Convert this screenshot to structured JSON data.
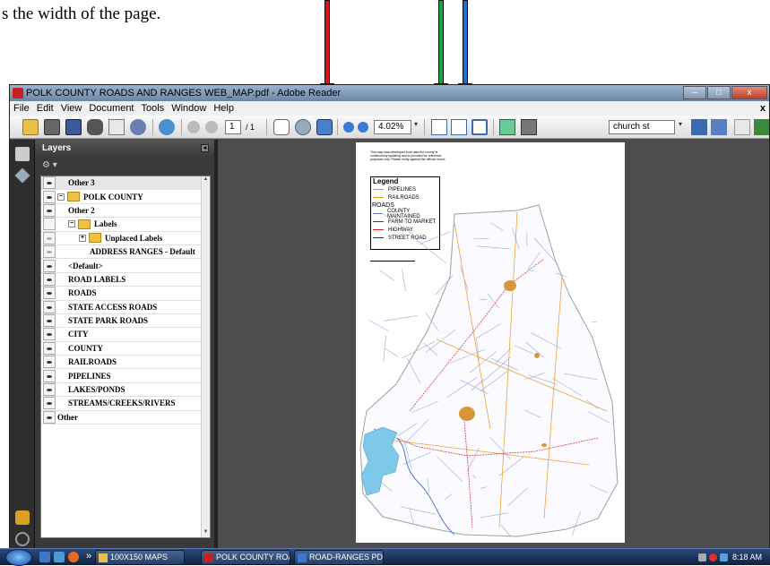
{
  "doc": {
    "caption": "s the width of the page."
  },
  "arrows": [
    {
      "name": "red",
      "color": "#e01414"
    },
    {
      "name": "green",
      "color": "#1aa83c"
    },
    {
      "name": "blue",
      "color": "#1f6fd6"
    }
  ],
  "window": {
    "title": "POLK COUNTY ROADS AND RANGES WEB_MAP.pdf - Adobe Reader",
    "controls": {
      "minimize": "–",
      "maximize": "□",
      "close": "x"
    }
  },
  "menu": {
    "items": [
      "File",
      "Edit",
      "View",
      "Document",
      "Tools",
      "Window",
      "Help"
    ],
    "close_doc": "x"
  },
  "toolbar": {
    "page_current": "1",
    "page_total": "/ 1",
    "zoom": "4.02%",
    "search_value": "church st"
  },
  "layers": {
    "title": "Layers",
    "options_label": "⚙ ▾",
    "collapse": "◂",
    "rows": [
      {
        "label": "Other 3",
        "indent": 1,
        "eye": "on",
        "folder": false,
        "plus": "",
        "selected": true
      },
      {
        "label": "POLK COUNTY",
        "indent": 0,
        "eye": "on",
        "folder": true,
        "plus": "−",
        "selected": false
      },
      {
        "label": "Other 2",
        "indent": 1,
        "eye": "on",
        "folder": false,
        "plus": "",
        "selected": false
      },
      {
        "label": "Labels",
        "indent": 1,
        "eye": "off",
        "folder": true,
        "plus": "−",
        "selected": false
      },
      {
        "label": "Unplaced Labels",
        "indent": 2,
        "eye": "dim",
        "folder": true,
        "plus": "+",
        "selected": false
      },
      {
        "label": "ADDRESS RANGES - Default",
        "indent": 3,
        "eye": "dim",
        "folder": false,
        "plus": "",
        "selected": false
      },
      {
        "label": "<Default>",
        "indent": 1,
        "eye": "on",
        "folder": false,
        "plus": "",
        "selected": false
      },
      {
        "label": "ROAD LABELS",
        "indent": 1,
        "eye": "on",
        "folder": false,
        "plus": "",
        "selected": false
      },
      {
        "label": "ROADS",
        "indent": 1,
        "eye": "on",
        "folder": false,
        "plus": "",
        "selected": false
      },
      {
        "label": "STATE ACCESS ROADS",
        "indent": 1,
        "eye": "on",
        "folder": false,
        "plus": "",
        "selected": false
      },
      {
        "label": "STATE PARK ROADS",
        "indent": 1,
        "eye": "on",
        "folder": false,
        "plus": "",
        "selected": false
      },
      {
        "label": "CITY",
        "indent": 1,
        "eye": "on",
        "folder": false,
        "plus": "",
        "selected": false
      },
      {
        "label": "COUNTY",
        "indent": 1,
        "eye": "on",
        "folder": false,
        "plus": "",
        "selected": false
      },
      {
        "label": "RAILROADS",
        "indent": 1,
        "eye": "on",
        "folder": false,
        "plus": "",
        "selected": false
      },
      {
        "label": "PIPELINES",
        "indent": 1,
        "eye": "on",
        "folder": false,
        "plus": "",
        "selected": false
      },
      {
        "label": "LAKES/PONDS",
        "indent": 1,
        "eye": "on",
        "folder": false,
        "plus": "",
        "selected": false
      },
      {
        "label": "STREAMS/CREEKS/RIVERS",
        "indent": 1,
        "eye": "on",
        "folder": false,
        "plus": "",
        "selected": false
      },
      {
        "label": "Other",
        "indent": 0,
        "eye": "on",
        "folder": false,
        "plus": "",
        "selected": false
      }
    ]
  },
  "map": {
    "note": "This map was developed from data the county is continuously updating and is provided for reference purposes only. Please verify against the official record.",
    "legend": {
      "title": "Legend",
      "items": [
        {
          "label": "PIPELINES",
          "color": "#e39a1a"
        },
        {
          "label": "RAILROADS",
          "color": "#e39a1a"
        },
        {
          "label": "ROADS",
          "color": "",
          "header": true
        },
        {
          "label": "COUNTY MAINTAINED",
          "color": "#6a7cc0"
        },
        {
          "label": "FARM TO MARKET",
          "color": "#444444"
        },
        {
          "label": "HIGHWAY",
          "color": "#d02020"
        },
        {
          "label": "STREET ROAD",
          "color": "#1a2a80"
        }
      ]
    },
    "colors": {
      "water": "#7ec8ea",
      "road": "#9aa8d6",
      "highway": "#d8364c",
      "pipeline": "#eaa23a",
      "city": "#d8953a",
      "boundary": "#a0a0a0"
    }
  },
  "taskbar": {
    "buttons": [
      {
        "label": "100X150 MAPS",
        "icon_color": "#e8c04a"
      },
      {
        "label": "POLK COUNTY ROA...",
        "icon_color": "#c62020"
      },
      {
        "label": "ROAD-RANGES PDF...",
        "icon_color": "#3a78c8"
      }
    ],
    "more": "»",
    "clock": "8:18 AM"
  }
}
